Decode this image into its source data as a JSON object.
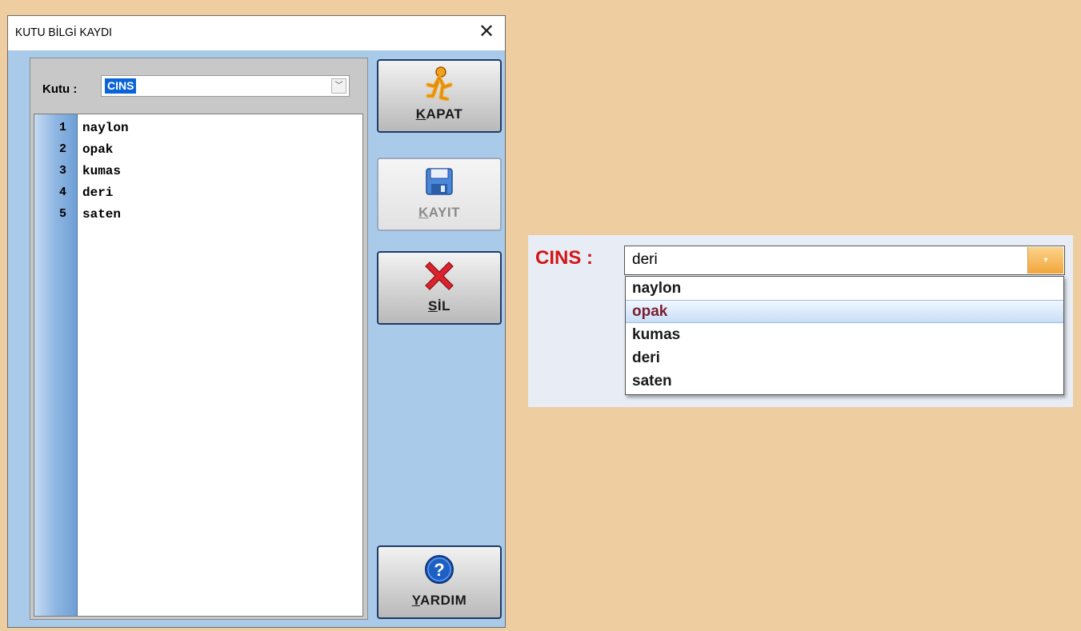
{
  "window": {
    "title": "KUTU BİLGİ KAYDI",
    "close_glyph": "✕"
  },
  "combo": {
    "label": "Kutu :",
    "value": "CINS",
    "arrow_glyph": "﹀"
  },
  "grid": {
    "rows": [
      {
        "num": "1",
        "value": "naylon"
      },
      {
        "num": "2",
        "value": "opak"
      },
      {
        "num": "3",
        "value": "kumas"
      },
      {
        "num": "4",
        "value": "deri"
      },
      {
        "num": "5",
        "value": "saten"
      }
    ]
  },
  "buttons": {
    "kapat": {
      "accel": "K",
      "rest": "APAT",
      "icon": "running-person-icon",
      "color": "#f5a21a"
    },
    "kayit": {
      "accel": "K",
      "rest": "AYIT",
      "icon": "floppy-disk-icon",
      "enabled": false
    },
    "sil": {
      "accel": "S",
      "rest": "İL",
      "icon": "red-x-icon",
      "color": "#d9232d"
    },
    "yardim": {
      "accel": "Y",
      "rest": "ARDIM",
      "icon": "help-icon",
      "color": "#1d5fc4"
    }
  },
  "zoom": {
    "label": "CINS :",
    "value": "deri",
    "arrow_glyph": "▾",
    "options": [
      "naylon",
      "opak",
      "kumas",
      "deri",
      "saten"
    ],
    "highlighted_index": 1,
    "label_color": "#d31616",
    "highlight_text_color": "#7a1f2f"
  }
}
